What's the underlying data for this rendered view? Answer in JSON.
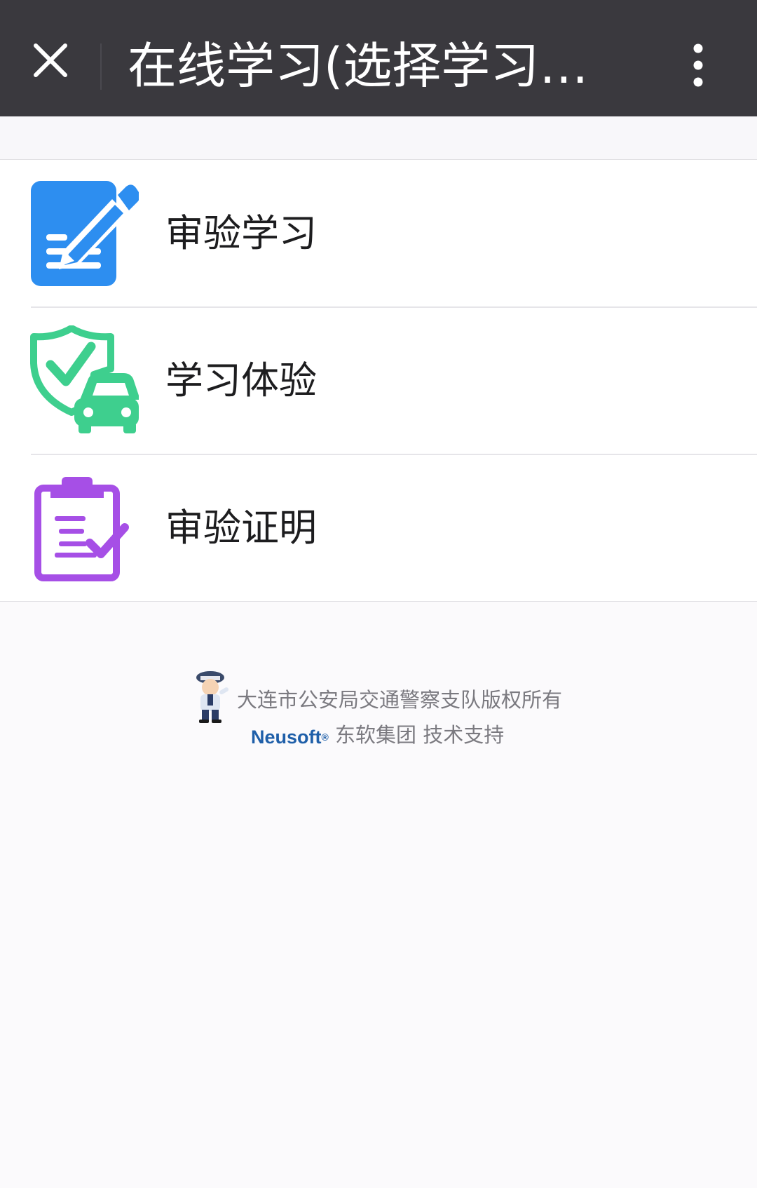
{
  "header": {
    "title": "在线学习(选择学习类..."
  },
  "menu": {
    "items": [
      {
        "label": "审验学习",
        "icon": "document-edit-icon"
      },
      {
        "label": "学习体验",
        "icon": "shield-car-icon"
      },
      {
        "label": "审验证明",
        "icon": "clipboard-check-icon"
      }
    ]
  },
  "footer": {
    "copyright": "大连市公安局交通警察支队版权所有",
    "brand": "Neusoft",
    "brand_mark": "®",
    "support": "东软集团 技术支持"
  },
  "colors": {
    "topbar_bg": "#3a393e",
    "icon_blue": "#2d8ef0",
    "icon_green": "#3ecf8e",
    "icon_purple": "#a64fe6",
    "brand_blue": "#1f5fa9"
  }
}
